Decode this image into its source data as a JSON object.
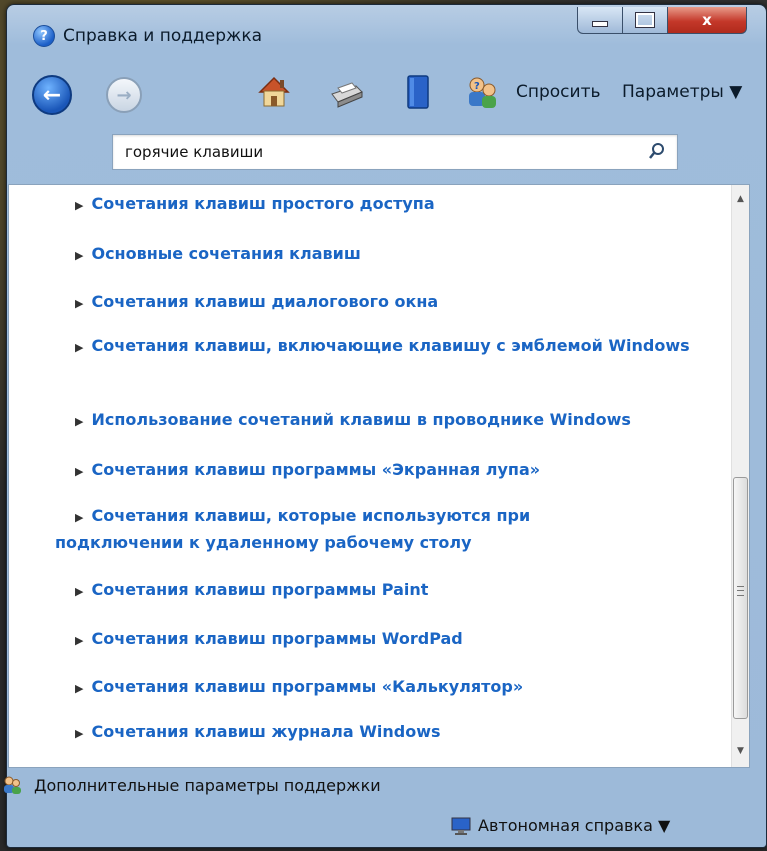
{
  "window": {
    "title": "Справка и поддержка",
    "controls": {
      "close": "x"
    }
  },
  "toolbar": {
    "ask_label": "Спросить",
    "params_label": "Параметры ▼"
  },
  "search": {
    "value": "горячие клавиши"
  },
  "links": [
    "Сочетания клавиш простого доступа",
    "Основные сочетания клавиш",
    "Сочетания клавиш диалогового окна",
    "Сочетания клавиш, включающие клавишу с эмблемой Windows",
    "Использование сочетаний клавиш в проводнике Windows",
    "Сочетания клавиш программы «Экранная лупа»",
    "Сочетания клавиш, которые используются при подключении к удаленному рабочему столу",
    "Сочетания клавиш программы Paint",
    "Сочетания клавиш программы WordPad",
    "Сочетания клавиш программы «Калькулятор»",
    "Сочетания клавиш журнала Windows"
  ],
  "footer": {
    "support_label": "Дополнительные параметры поддержки",
    "offline_label": "Автономная справка ▼"
  },
  "colors": {
    "link": "#1a65c4",
    "frame": "#9dbad9",
    "close_button": "#c4382a"
  }
}
